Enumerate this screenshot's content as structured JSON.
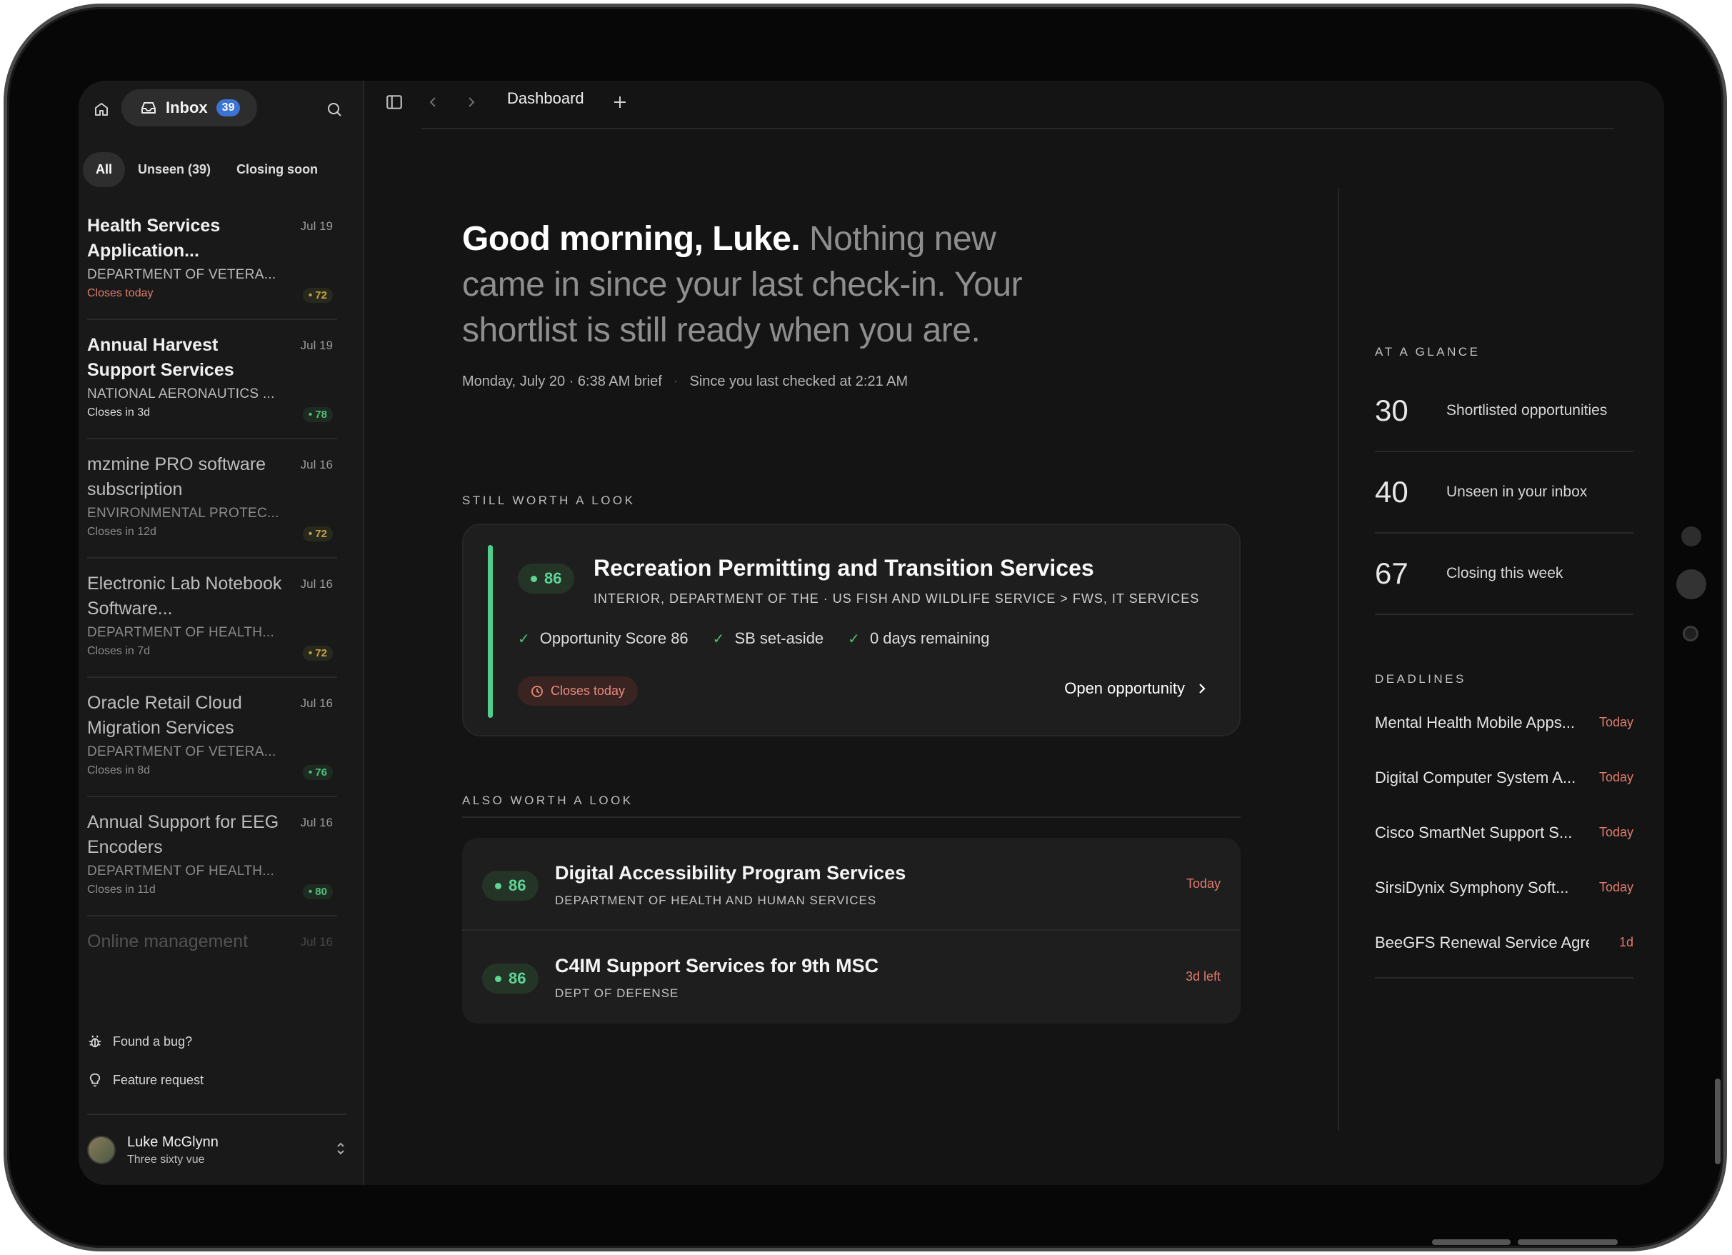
{
  "sidebar": {
    "inbox_label": "Inbox",
    "inbox_count": "39",
    "filters": [
      "All",
      "Unseen (39)",
      "Closing soon"
    ],
    "items": [
      {
        "title": "Health Services Application...",
        "date": "Jul 19",
        "agency": "DEPARTMENT OF VETERA...",
        "score": "• 72",
        "closes": "Closes today"
      },
      {
        "title": "Annual Harvest Support Services",
        "date": "Jul 19",
        "agency": "NATIONAL AERONAUTICS ...",
        "score": "• 78",
        "closes": "Closes in 3d"
      },
      {
        "title": "mzmine PRO software subscription",
        "date": "Jul 16",
        "agency": "ENVIRONMENTAL PROTEC...",
        "score": "• 72",
        "closes": "Closes in 12d"
      },
      {
        "title": "Electronic Lab Notebook Software...",
        "date": "Jul 16",
        "agency": "DEPARTMENT OF HEALTH...",
        "score": "• 72",
        "closes": "Closes in 7d"
      },
      {
        "title": "Oracle Retail Cloud Migration Services",
        "date": "Jul 16",
        "agency": "DEPARTMENT OF VETERA...",
        "score": "• 76",
        "closes": "Closes in 8d"
      },
      {
        "title": "Annual Support for EEG Encoders",
        "date": "Jul 16",
        "agency": "DEPARTMENT OF HEALTH...",
        "score": "• 80",
        "closes": "Closes in 11d"
      },
      {
        "title": "Online management",
        "date": "Jul 16"
      }
    ],
    "footer": {
      "bug": "Found a bug?",
      "feature": "Feature request"
    },
    "user": {
      "name": "Luke McGlynn",
      "org": "Three sixty vue"
    }
  },
  "topbar": {
    "tab_title": "Dashboard"
  },
  "hero": {
    "greeting": "Good morning, Luke.",
    "message": " Nothing new came in since your last check-in. Your shortlist is still ready when you are.",
    "brief": "Monday, July 20 · 6:38 AM brief",
    "separator": "·",
    "last_checked": "Since you last checked at 2:21 AM"
  },
  "still_worth": {
    "heading": "STILL WORTH A LOOK",
    "score": "86",
    "title": "Recreation Permitting and Transition Services",
    "agency": "INTERIOR, DEPARTMENT OF THE · US FISH AND WILDLIFE SERVICE > FWS, IT SERVICES",
    "checks": [
      "Opportunity Score 86",
      "SB set-aside",
      "0 days remaining"
    ],
    "closes": "Closes today",
    "open_label": "Open opportunity"
  },
  "also_worth": {
    "heading": "ALSO WORTH A LOOK",
    "rows": [
      {
        "score": "86",
        "title": "Digital Accessibility Program Services",
        "agency": "DEPARTMENT OF HEALTH AND HUMAN SERVICES",
        "due": "Today"
      },
      {
        "score": "86",
        "title": "C4IM Support Services for 9th MSC",
        "agency": "DEPT OF DEFENSE",
        "due": "3d left"
      }
    ]
  },
  "glance": {
    "heading": "AT A GLANCE",
    "stats": [
      {
        "num": "30",
        "desc": "Shortlisted opportunities"
      },
      {
        "num": "40",
        "desc": "Unseen in your inbox"
      },
      {
        "num": "67",
        "desc": "Closing this week"
      }
    ]
  },
  "deadlines": {
    "heading": "DEADLINES",
    "items": [
      {
        "name": "Mental Health Mobile Apps...",
        "when": "Today"
      },
      {
        "name": "Digital Computer System A...",
        "when": "Today"
      },
      {
        "name": "Cisco SmartNet Support S...",
        "when": "Today"
      },
      {
        "name": "SirsiDynix Symphony Soft...",
        "when": "Today"
      },
      {
        "name": "BeeGFS Renewal Service Agre...",
        "when": "1d"
      }
    ]
  },
  "colors": {
    "accent_green": "#4fcf89",
    "urgent_red": "#e07b6e",
    "inbox_badge": "#3c74d6"
  }
}
